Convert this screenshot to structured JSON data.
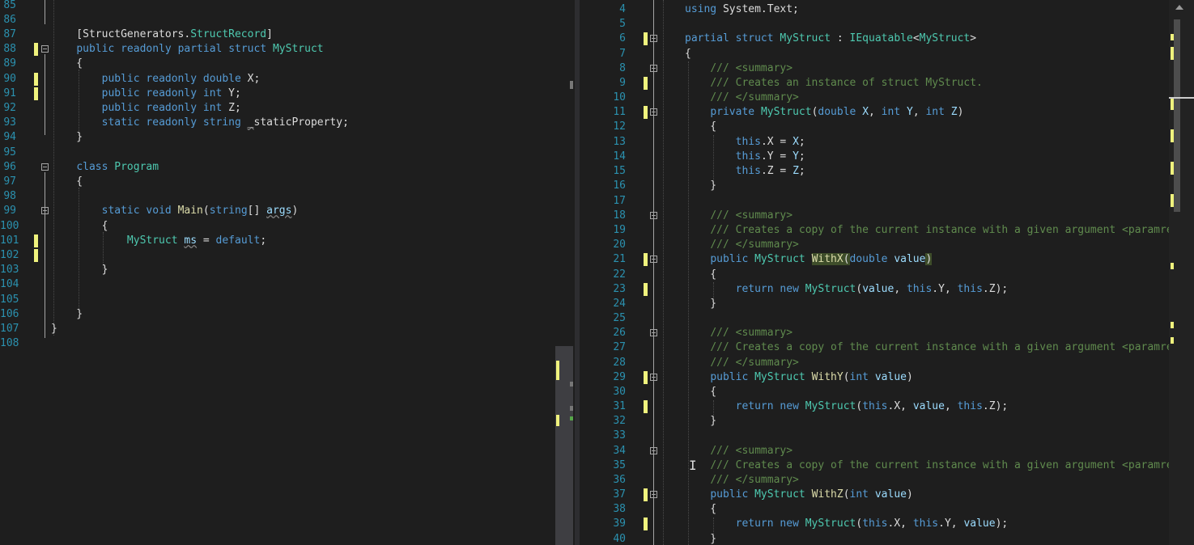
{
  "left_editor": {
    "lines": [
      {
        "n": "85",
        "t": ""
      },
      {
        "n": "86",
        "t": ""
      },
      {
        "n": "87",
        "t": "    [StructGenerators.StructRecord]"
      },
      {
        "n": "88",
        "t": "    public readonly partial struct MyStruct"
      },
      {
        "n": "89",
        "t": "    {"
      },
      {
        "n": "90",
        "t": "        public readonly double X;"
      },
      {
        "n": "91",
        "t": "        public readonly int Y;"
      },
      {
        "n": "92",
        "t": "        public readonly int Z;"
      },
      {
        "n": "93",
        "t": "        static readonly string _staticProperty;"
      },
      {
        "n": "94",
        "t": "    }"
      },
      {
        "n": "95",
        "t": ""
      },
      {
        "n": "96",
        "t": "    class Program"
      },
      {
        "n": "97",
        "t": "    {"
      },
      {
        "n": "98",
        "t": ""
      },
      {
        "n": "99",
        "t": "        static void Main(string[] args)"
      },
      {
        "n": "100",
        "t": "        {"
      },
      {
        "n": "101",
        "t": "            MyStruct ms = default;"
      },
      {
        "n": "102",
        "t": ""
      },
      {
        "n": "103",
        "t": "        }"
      },
      {
        "n": "104",
        "t": ""
      },
      {
        "n": "105",
        "t": ""
      },
      {
        "n": "106",
        "t": "    }"
      },
      {
        "n": "107",
        "t": "}"
      },
      {
        "n": "108",
        "t": ""
      }
    ]
  },
  "right_editor": {
    "lines": [
      {
        "n": "4",
        "t": "using System.Text;"
      },
      {
        "n": "5",
        "t": ""
      },
      {
        "n": "6",
        "t": "partial struct MyStruct : IEquatable<MyStruct>"
      },
      {
        "n": "7",
        "t": "{"
      },
      {
        "n": "8",
        "t": "    /// <summary>"
      },
      {
        "n": "9",
        "t": "    /// Creates an instance of struct MyStruct."
      },
      {
        "n": "10",
        "t": "    /// </summary>"
      },
      {
        "n": "11",
        "t": "    private MyStruct(double X, int Y, int Z)"
      },
      {
        "n": "12",
        "t": "    {"
      },
      {
        "n": "13",
        "t": "        this.X = X;"
      },
      {
        "n": "14",
        "t": "        this.Y = Y;"
      },
      {
        "n": "15",
        "t": "        this.Z = Z;"
      },
      {
        "n": "16",
        "t": "    }"
      },
      {
        "n": "17",
        "t": ""
      },
      {
        "n": "18",
        "t": "    /// <summary>"
      },
      {
        "n": "19",
        "t": "    /// Creates a copy of the current instance with a given argument <paramref"
      },
      {
        "n": "20",
        "t": "    /// </summary>"
      },
      {
        "n": "21",
        "t": "    public MyStruct WithX(double value)"
      },
      {
        "n": "22",
        "t": "    {"
      },
      {
        "n": "23",
        "t": "        return new MyStruct(value, this.Y, this.Z);"
      },
      {
        "n": "24",
        "t": "    }"
      },
      {
        "n": "25",
        "t": ""
      },
      {
        "n": "26",
        "t": "    /// <summary>"
      },
      {
        "n": "27",
        "t": "    /// Creates a copy of the current instance with a given argument <paramref"
      },
      {
        "n": "28",
        "t": "    /// </summary>"
      },
      {
        "n": "29",
        "t": "    public MyStruct WithY(int value)"
      },
      {
        "n": "30",
        "t": "    {"
      },
      {
        "n": "31",
        "t": "        return new MyStruct(this.X, value, this.Z);"
      },
      {
        "n": "32",
        "t": "    }"
      },
      {
        "n": "33",
        "t": ""
      },
      {
        "n": "34",
        "t": "    /// <summary>"
      },
      {
        "n": "35",
        "t": "    /// Creates a copy of the current instance with a given argument <paramref"
      },
      {
        "n": "36",
        "t": "    /// </summary>"
      },
      {
        "n": "37",
        "t": "    public MyStruct WithZ(int value)"
      },
      {
        "n": "38",
        "t": "    {"
      },
      {
        "n": "39",
        "t": "        return new MyStruct(this.X, this.Y, value);"
      },
      {
        "n": "40",
        "t": "    }"
      }
    ]
  },
  "colors": {
    "background": "#1e1e1e",
    "line_number": "#2b91af",
    "keyword": "#569cd6",
    "type": "#4ec9b0",
    "comment": "#57a64a",
    "change_marker": "#eff27d"
  }
}
